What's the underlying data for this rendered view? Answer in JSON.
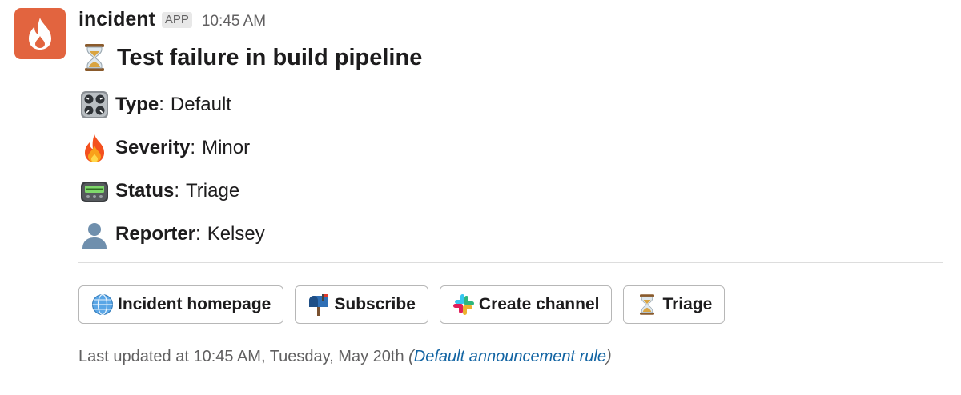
{
  "message": {
    "sender": "incident",
    "badge": "APP",
    "timestamp": "10:45 AM",
    "title_icon": "hourglass-icon",
    "title": "Test failure in build pipeline"
  },
  "fields": [
    {
      "icon": "control-knobs-icon",
      "label": "Type",
      "value": "Default"
    },
    {
      "icon": "fire-icon",
      "label": "Severity",
      "value": "Minor"
    },
    {
      "icon": "pager-icon",
      "label": "Status",
      "value": "Triage"
    },
    {
      "icon": "user-silhouette-icon",
      "label": "Reporter",
      "value": "Kelsey"
    }
  ],
  "separator": ":",
  "buttons": [
    {
      "icon": "globe-icon",
      "label": "Incident homepage"
    },
    {
      "icon": "mailbox-icon",
      "label": "Subscribe"
    },
    {
      "icon": "slack-logo-icon",
      "label": "Create channel"
    },
    {
      "icon": "hourglass-icon",
      "label": "Triage"
    }
  ],
  "footer": {
    "prefix": "Last updated at 10:45 AM, Tuesday, May 20th ",
    "open_paren": "(",
    "link": "Default announcement rule",
    "close_paren": ")"
  },
  "colors": {
    "avatar_bg": "#e2643f",
    "link": "#1264a3",
    "muted_text": "#616061"
  }
}
